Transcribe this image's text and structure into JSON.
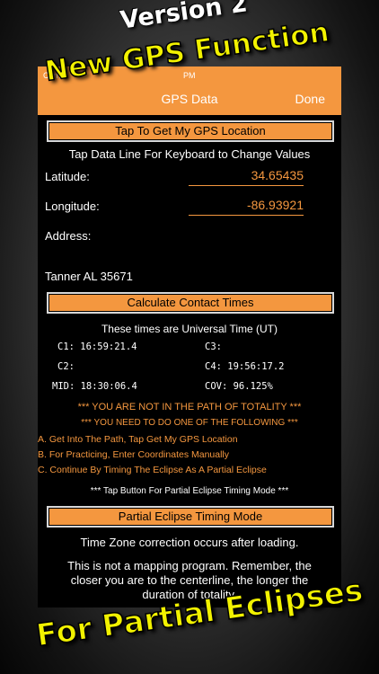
{
  "promo": {
    "top": "Version 2",
    "middle": "New GPS Function",
    "bottom": "For Partial Eclipses"
  },
  "status": {
    "carrier": "Carrier",
    "time": "PM"
  },
  "nav": {
    "title": "GPS Data",
    "done_label": "Done"
  },
  "gps_button": "Tap To Get My GPS Location",
  "instructions": "Tap Data Line For Keyboard to Change Values",
  "latitude": {
    "label": "Latitude:",
    "value": "34.65435"
  },
  "longitude": {
    "label": "Longitude:",
    "value": "-86.93921"
  },
  "address": {
    "label": "Address:",
    "value": "Tanner AL 35671"
  },
  "calc_button": "Calculate Contact Times",
  "times_note": "These times are Universal Time (UT)",
  "contacts": {
    "c1": "C1: 16:59:21.4",
    "c2": "C2:",
    "mid": "MID: 18:30:06.4",
    "c3": "C3:",
    "c4": "C4: 19:56:17.2",
    "cov": "COV: 96.125%"
  },
  "warning1": "*** YOU ARE NOT IN THE PATH OF TOTALITY ***",
  "warning2": "*** YOU NEED TO DO ONE OF THE FOLLOWING ***",
  "options": [
    "A. Get Into The Path, Tap Get My GPS Location",
    "B. For Practicing, Enter Coordinates Manually",
    "C. Continue By Timing The Eclipse As A Partial Eclipse"
  ],
  "tap_note": "*** Tap Button For Partial Eclipse Timing Mode ***",
  "partial_button": "Partial Eclipse Timing Mode",
  "timezone_note": "Time Zone correction occurs after loading.",
  "mapping_note": "This is not a mapping program. Remember, the closer you are to the centerline, the longer the duration of totality."
}
